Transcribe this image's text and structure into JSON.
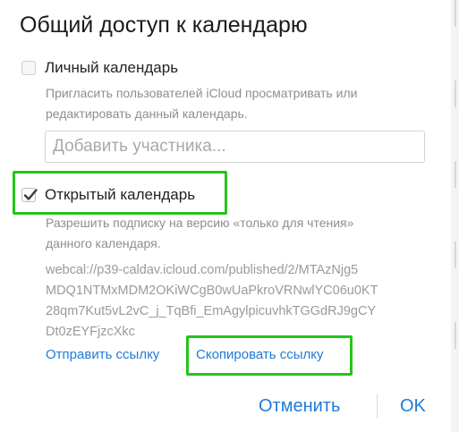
{
  "dialog": {
    "title": "Общий доступ к календарю",
    "private": {
      "label": "Личный календарь",
      "checked": false,
      "description": "Пригласить пользователей iCloud просматривать или\nредактировать данный календарь.",
      "add_placeholder": "Добавить участника..."
    },
    "public": {
      "label": "Открытый календарь",
      "checked": true,
      "description": "Разрешить подписку на версию «только для чтения»\nданного календаря.",
      "url": "webcal://p39-caldav.icloud.com/published/2/MTAzNjg5\nMDQ1NTMxMDM2OKiWCgB0wUaPkroVRNwlYC06u0KT\n28qm7Kut5vL2vC_j_TqBfi_EmAgylpicuvhkTGGdRJ9gCY\nDt0zEYFjzcXkc",
      "send_link": "Отправить ссылку",
      "copy_link": "Скопировать ссылку"
    },
    "buttons": {
      "cancel": "Отменить",
      "ok": "OK"
    }
  },
  "colors": {
    "accent": "#1f7ad9",
    "highlight": "#25c41c"
  }
}
